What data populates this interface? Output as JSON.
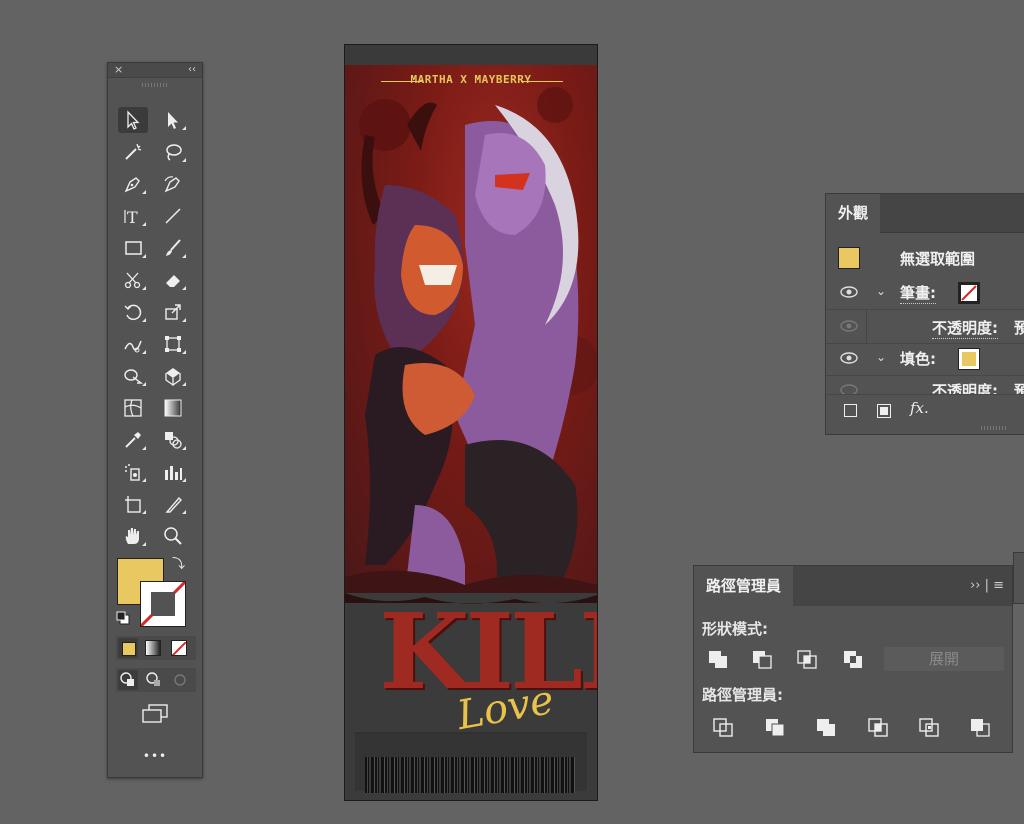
{
  "artwork": {
    "header_text": "MARTHA X MAYBERRY",
    "kill_text": "KILL",
    "love_text": "Love"
  },
  "tools_panel": {
    "close_glyph": "×",
    "collapse_glyph": "‹‹",
    "more_label": "•••",
    "fill_color": "#e9c862",
    "tools": [
      "selection-tool",
      "direct-selection-tool",
      "magic-wand-tool",
      "lasso-tool",
      "pen-tool",
      "curvature-tool",
      "type-tool",
      "line-segment-tool",
      "rectangle-tool",
      "paintbrush-tool",
      "scissors-tool",
      "eraser-tool",
      "rotate-tool",
      "scale-tool",
      "warp-tool",
      "free-transform-tool",
      "shape-builder-tool",
      "perspective-grid-tool",
      "mesh-tool",
      "gradient-tool",
      "eyedropper-tool",
      "blend-tool",
      "symbol-sprayer-tool",
      "column-graph-tool",
      "artboard-tool",
      "slice-tool",
      "hand-tool",
      "zoom-tool"
    ]
  },
  "appearance_panel": {
    "tab_label": "外觀",
    "selection_label": "無選取範圍",
    "stroke_label": "筆畫:",
    "opacity_label_1": "不透明度:",
    "opacity_value_1": "預",
    "fill_label": "填色:",
    "opacity_label_2": "不透明度:",
    "opacity_value_2": "預",
    "fx_label": "fx.",
    "fill_color": "#e9c862"
  },
  "pathfinder_panel": {
    "tab_label": "路徑管理員",
    "menu_glyphs": "›› | ≡",
    "shape_modes_label": "形狀模式:",
    "expand_label": "展開",
    "pathfinders_label": "路徑管理員:"
  },
  "colors": {
    "background": "#636363",
    "panel": "#535353",
    "accent_fill": "#e9c862",
    "none_red": "#d22b2b"
  }
}
